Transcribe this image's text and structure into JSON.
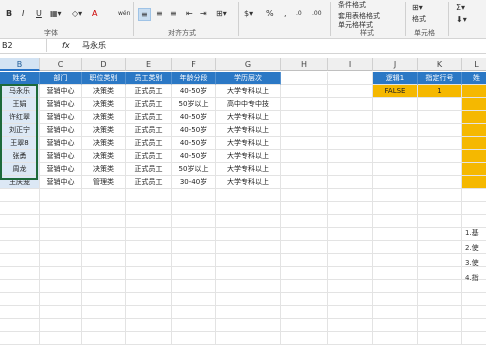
{
  "ribbon": {
    "font_bold": "B",
    "font_italic": "I",
    "font_underline": "U",
    "font_color_glyph": "A",
    "phonetic_glyph": "wén",
    "wrap_glyph": "abc",
    "merge_label": "合并后居中",
    "percent": "%",
    "comma": ",",
    "decimal_inc": ".0",
    "decimal_dec": ".00",
    "cond_format": "条件格式",
    "table_format": "套用表格格式",
    "cell_style": "单元格样式",
    "format_label": "格式",
    "groups": {
      "font": "字体",
      "alignment": "对齐方式",
      "styles": "样式",
      "cells": "单元格"
    }
  },
  "formula_bar": {
    "name_box": "B2",
    "fx": "fx",
    "value": "马永乐"
  },
  "columns": [
    "B",
    "C",
    "D",
    "E",
    "F",
    "G",
    "H",
    "I",
    "J",
    "K",
    "L"
  ],
  "table": {
    "headers": [
      "姓名",
      "部门",
      "职位类别",
      "员工类别",
      "年龄分段",
      "学历层次"
    ],
    "rows": [
      [
        "马永乐",
        "营销中心",
        "决策类",
        "正式员工",
        "40-50岁",
        "大学专科以上"
      ],
      [
        "王娟",
        "营销中心",
        "决策类",
        "正式员工",
        "50岁以上",
        "高中中专中技"
      ],
      [
        "许红翠",
        "营销中心",
        "决策类",
        "正式员工",
        "40-50岁",
        "大学专科以上"
      ],
      [
        "刘正宁",
        "营销中心",
        "决策类",
        "正式员工",
        "40-50岁",
        "大学专科以上"
      ],
      [
        "王翠8",
        "营销中心",
        "决策类",
        "正式员工",
        "40-50岁",
        "大学专科以上"
      ],
      [
        "张勇",
        "营销中心",
        "决策类",
        "正式员工",
        "40-50岁",
        "大学专科以上"
      ],
      [
        "周龙",
        "营销中心",
        "决策类",
        "正式员工",
        "50岁以上",
        "大学专科以上"
      ],
      [
        "王庆宠",
        "营销中心",
        "管理类",
        "正式员工",
        "30-40岁",
        "大学专科以上"
      ]
    ]
  },
  "side_table": {
    "headers": [
      "逻辑1",
      "指定行号",
      "姓"
    ],
    "values": [
      "FALSE",
      "1",
      ""
    ]
  },
  "notes": [
    "1.基",
    "2.使",
    "3.使",
    "4.指"
  ]
}
